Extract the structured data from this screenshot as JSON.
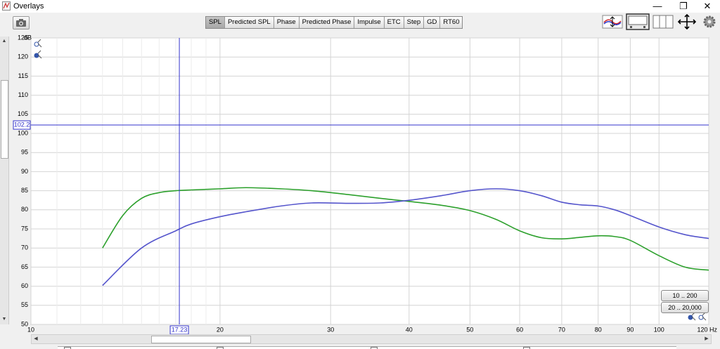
{
  "window": {
    "title": "Overlays",
    "minimize_symbol": "—",
    "restore_symbol": "❐",
    "close_symbol": "✕"
  },
  "tabs": [
    {
      "label": "SPL",
      "active": true
    },
    {
      "label": "Predicted SPL",
      "active": false
    },
    {
      "label": "Phase",
      "active": false
    },
    {
      "label": "Predicted Phase",
      "active": false
    },
    {
      "label": "Impulse",
      "active": false
    },
    {
      "label": "ETC",
      "active": false
    },
    {
      "label": "Step",
      "active": false
    },
    {
      "label": "GD",
      "active": false
    },
    {
      "label": "RT60",
      "active": false
    }
  ],
  "toolbar_icons": [
    "camera-icon",
    "overlay-traces-icon",
    "frequency-response-icon",
    "grid-panes-icon",
    "fit-axes-icon",
    "settings-gear-icon"
  ],
  "zoom_buttons": {
    "range1": "10 .. 200",
    "range2": "20 .. 20,000"
  },
  "chart_data": {
    "type": "line",
    "ylabel": "dB",
    "xunit": "Hz",
    "x_scale": "log",
    "xlim": [
      10,
      120
    ],
    "ylim": [
      50,
      125
    ],
    "grid": true,
    "xticks": [
      10,
      20,
      30,
      40,
      50,
      60,
      70,
      80,
      90,
      100,
      120
    ],
    "xtick_labels": [
      "10",
      "20",
      "30",
      "40",
      "50",
      "60",
      "70",
      "80",
      "90",
      "100",
      "120 Hz"
    ],
    "yticks": [
      50,
      55,
      60,
      65,
      70,
      75,
      80,
      85,
      90,
      95,
      100,
      105,
      110,
      115,
      120,
      125
    ],
    "cursor": {
      "x": 17.23,
      "y": 102.2,
      "x_label": "17.23",
      "y_label": "102.2"
    },
    "series": [
      {
        "color": "#2ca02c",
        "x": [
          13,
          14,
          15,
          16,
          17,
          18,
          20,
          22,
          25,
          28,
          32,
          36,
          40,
          45,
          50,
          55,
          60,
          65,
          70,
          75,
          80,
          85,
          90,
          100,
          110,
          120
        ],
        "y": [
          70.0,
          78.5,
          83.0,
          84.5,
          85.0,
          85.2,
          85.5,
          85.8,
          85.5,
          85.0,
          84.0,
          83.0,
          82.2,
          81.2,
          79.8,
          77.5,
          74.5,
          72.7,
          72.4,
          72.8,
          73.2,
          73.0,
          72.0,
          68.0,
          65.0,
          64.2
        ]
      },
      {
        "color": "#5555cc",
        "x": [
          13,
          15,
          17,
          18,
          20,
          22,
          25,
          28,
          32,
          36,
          40,
          45,
          50,
          55,
          60,
          65,
          70,
          75,
          80,
          85,
          90,
          100,
          110,
          120
        ],
        "y": [
          60.2,
          70.0,
          74.5,
          76.3,
          78.2,
          79.5,
          81.0,
          81.8,
          81.7,
          81.8,
          82.5,
          83.7,
          85.0,
          85.5,
          85.0,
          83.7,
          82.0,
          81.3,
          81.0,
          80.0,
          78.5,
          75.5,
          73.5,
          72.5
        ]
      }
    ]
  }
}
